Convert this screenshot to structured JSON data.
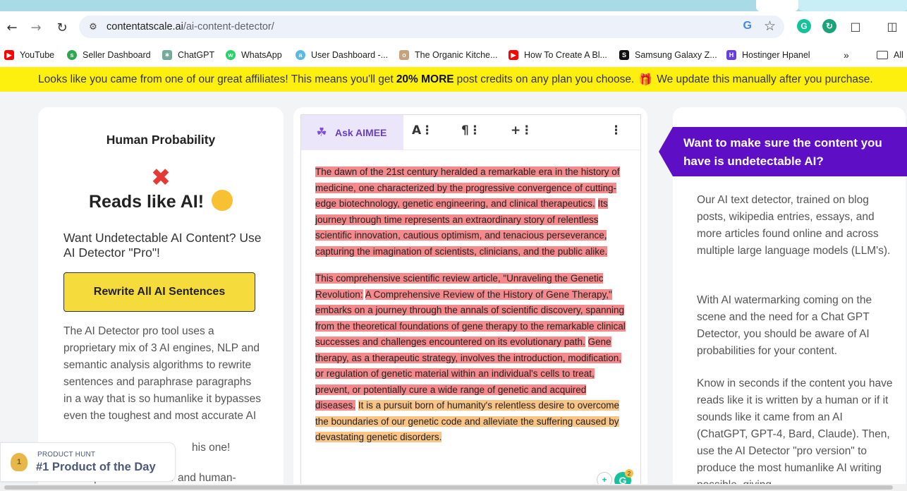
{
  "browser": {
    "url_host": "contentatscale.ai",
    "url_path": "/ai-content-detector/",
    "bookmarks": [
      {
        "label": "YouTube",
        "color": "#ff0000"
      },
      {
        "label": "Seller Dashboard",
        "color": "#2ea84f"
      },
      {
        "label": "ChatGPT",
        "color": "#74aa9c"
      },
      {
        "label": "WhatsApp",
        "color": "#25d366"
      },
      {
        "label": "User Dashboard -...",
        "color": "#5ab8e6"
      },
      {
        "label": "The Organic Kitche...",
        "color": "#c7a27a"
      },
      {
        "label": "How To Create A Bl...",
        "color": "#ff0000"
      },
      {
        "label": "Samsung Galaxy Z...",
        "color": "#111111"
      },
      {
        "label": "Hostinger Hpanel",
        "color": "#673de6"
      }
    ],
    "all_bookmarks": "All"
  },
  "banner": {
    "text_before": "Looks like you came from one of our great affiliates! This means you'll get",
    "bold": "20% MORE",
    "text_after": "post credits on any plan you choose.",
    "text_end": "We update this manually after you purchase."
  },
  "left": {
    "title": "Human Probability",
    "verdict": "Reads like AI!",
    "want": "Want Undetectable AI Content? Use AI Detector \"Pro\"!",
    "button": "Rewrite All AI Sentences",
    "desc": "The AI Detector pro tool uses a proprietary mix of 3 AI engines, NLP and semantic analysis algorithms to rewrite sentences and paraphrase paragraphs in a way that is so humanlike it bypasses even the toughest and most accurate AI",
    "desc_tail": "his one!",
    "desc2": "A complete AI Detector and human-"
  },
  "product_hunt": {
    "label": "PRODUCT HUNT",
    "title": "#1 Product of the Day",
    "rank": "1"
  },
  "editor": {
    "aimee": "Ask AIMEE",
    "tools": [
      "A⋮",
      "¶⋮",
      "+⋮",
      "⋮"
    ],
    "p1": [
      {
        "t": "The dawn of the 21st century heralded a remarkable era in the history of medicine, one characterized by the progressive convergence of cutting-edge biotechnology, genetic engineering, and clinical therapeutics.",
        "c": "red"
      },
      {
        "t": "Its journey through time represents an extraordinary story of relentless scientific innovation, cautious optimism, and tenacious perseverance, capturing the imagination of scientists, clinicians, and the public alike.",
        "c": "red"
      }
    ],
    "p2": [
      {
        "t": "This comprehensive scientific review article, \"Unraveling the Genetic Revolution:",
        "c": "red"
      },
      {
        "t": "A Comprehensive Review of the History of Gene Therapy,\" embarks on a journey through the annals of scientific discovery, spanning from the theoretical foundations of gene therapy to the remarkable clinical successes and challenges encountered on its evolutionary path.",
        "c": "red"
      },
      {
        "t": "Gene therapy, as a therapeutic strategy, involves the introduction, modification, or regulation of genetic material within an individual's cells to treat, prevent, or potentially cure a wide range of genetic and acquired diseases.",
        "c": "red"
      },
      {
        "t": "It is a pursuit born of humanity's relentless desire to overcome the boundaries of our genetic code and alleviate the suffering caused by devastating genetic disorders.",
        "c": "orange"
      }
    ],
    "grammarly_count": "2"
  },
  "right": {
    "flag": "Want to make sure the content you have is undetectable AI?",
    "p1": "Our AI text detector, trained on blog posts, wikipedia entries, essays, and more articles found online and across multiple large language models (LLM's).",
    "p2": "With AI watermarking coming on the scene and the need for a Chat GPT Detector, you should be aware of AI probabilities for your content.",
    "p3": "Know in seconds if the content you have reads like it is written by a human or if it sounds like it came from an AI (ChatGPT, GPT-4, Bard, Claude). Then, use the AI Detector \"pro version\" to produce the most humanlike AI writing possible, giving"
  }
}
